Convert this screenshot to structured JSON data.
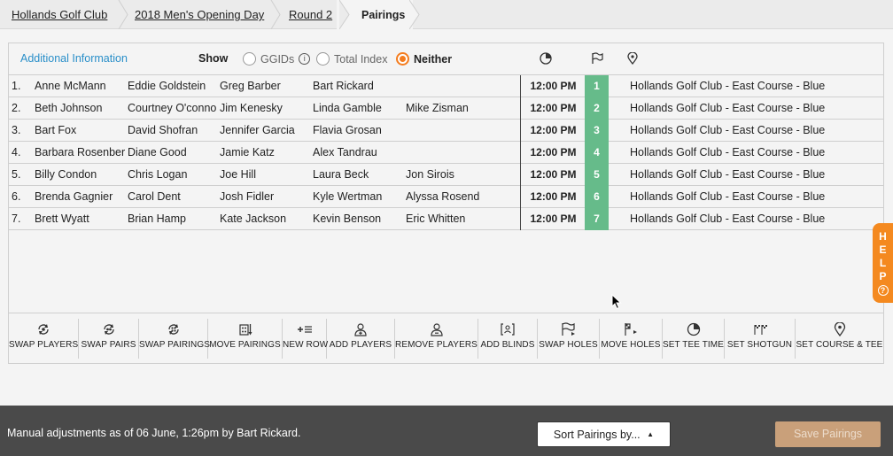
{
  "breadcrumb": {
    "items": [
      "Hollands Golf Club",
      "2018 Men's Opening Day",
      "Round 2",
      "Pairings"
    ]
  },
  "infobar": {
    "additional_info": "Additional Information",
    "show_label": "Show",
    "options": [
      "GGIDs",
      "Total Index",
      "Neither"
    ],
    "selected": "Neither"
  },
  "pairings": [
    {
      "num": "1.",
      "players": [
        "Anne McMann",
        "Eddie Goldstein",
        "Greg Barber",
        "Bart Rickard",
        ""
      ],
      "tee_time": "12:00 PM",
      "hole": "1",
      "course": "Hollands Golf Club - East Course - Blue"
    },
    {
      "num": "2.",
      "players": [
        "Beth Johnson",
        "Courtney O'conno",
        "Jim Kenesky",
        "Linda Gamble",
        "Mike Zisman"
      ],
      "tee_time": "12:00 PM",
      "hole": "2",
      "course": "Hollands Golf Club - East Course - Blue"
    },
    {
      "num": "3.",
      "players": [
        "Bart Fox",
        "David Shofran",
        "Jennifer Garcia",
        "Flavia Grosan",
        ""
      ],
      "tee_time": "12:00 PM",
      "hole": "3",
      "course": "Hollands Golf Club - East Course - Blue"
    },
    {
      "num": "4.",
      "players": [
        "Barbara Rosenber",
        "Diane Good",
        "Jamie Katz",
        "Alex Tandrau",
        ""
      ],
      "tee_time": "12:00 PM",
      "hole": "4",
      "course": "Hollands Golf Club - East Course - Blue"
    },
    {
      "num": "5.",
      "players": [
        "Billy Condon",
        "Chris Logan",
        "Joe Hill",
        "Laura Beck",
        "Jon Sirois"
      ],
      "tee_time": "12:00 PM",
      "hole": "5",
      "course": "Hollands Golf Club - East Course - Blue"
    },
    {
      "num": "6.",
      "players": [
        "Brenda Gagnier",
        "Carol Dent",
        "Josh Fidler",
        "Kyle Wertman",
        "Alyssa Rosend"
      ],
      "tee_time": "12:00 PM",
      "hole": "6",
      "course": "Hollands Golf Club - East Course - Blue"
    },
    {
      "num": "7.",
      "players": [
        "Brett Wyatt",
        "Brian Hamp",
        "Kate Jackson",
        "Kevin Benson",
        "Eric Whitten"
      ],
      "tee_time": "12:00 PM",
      "hole": "7",
      "course": "Hollands Golf Club - East Course - Blue"
    }
  ],
  "toolbar": [
    {
      "label": "SWAP PLAYERS",
      "icon": "swap-players-icon"
    },
    {
      "label": "SWAP PAIRS",
      "icon": "swap-pairs-icon"
    },
    {
      "label": "SWAP PAIRINGS",
      "icon": "swap-pairings-icon"
    },
    {
      "label": "MOVE PAIRINGS",
      "icon": "move-pairings-icon"
    },
    {
      "label": "NEW ROW",
      "icon": "new-row-icon"
    },
    {
      "label": "ADD PLAYERS",
      "icon": "add-players-icon"
    },
    {
      "label": "REMOVE PLAYERS",
      "icon": "remove-players-icon"
    },
    {
      "label": "ADD BLINDS",
      "icon": "add-blinds-icon"
    },
    {
      "label": "SWAP HOLES",
      "icon": "swap-holes-icon"
    },
    {
      "label": "MOVE HOLES",
      "icon": "move-holes-icon"
    },
    {
      "label": "SET TEE TIME",
      "icon": "tee-time-icon"
    },
    {
      "label": "SET SHOTGUN",
      "icon": "shotgun-icon"
    },
    {
      "label": "SET COURSE & TEE",
      "icon": "course-tee-icon"
    }
  ],
  "help": {
    "letters": [
      "H",
      "E",
      "L",
      "P"
    ],
    "icon": "question-icon"
  },
  "footer": {
    "message": "Manual adjustments as of 06 June, 1:26pm by Bart Rickard.",
    "sort_label": "Sort Pairings by...",
    "save_label": "Save Pairings"
  },
  "colors": {
    "accent": "#f47c1e",
    "hole_green": "#66bb8a",
    "link": "#2a8fc9",
    "footer_bg": "#4a4a4a"
  }
}
